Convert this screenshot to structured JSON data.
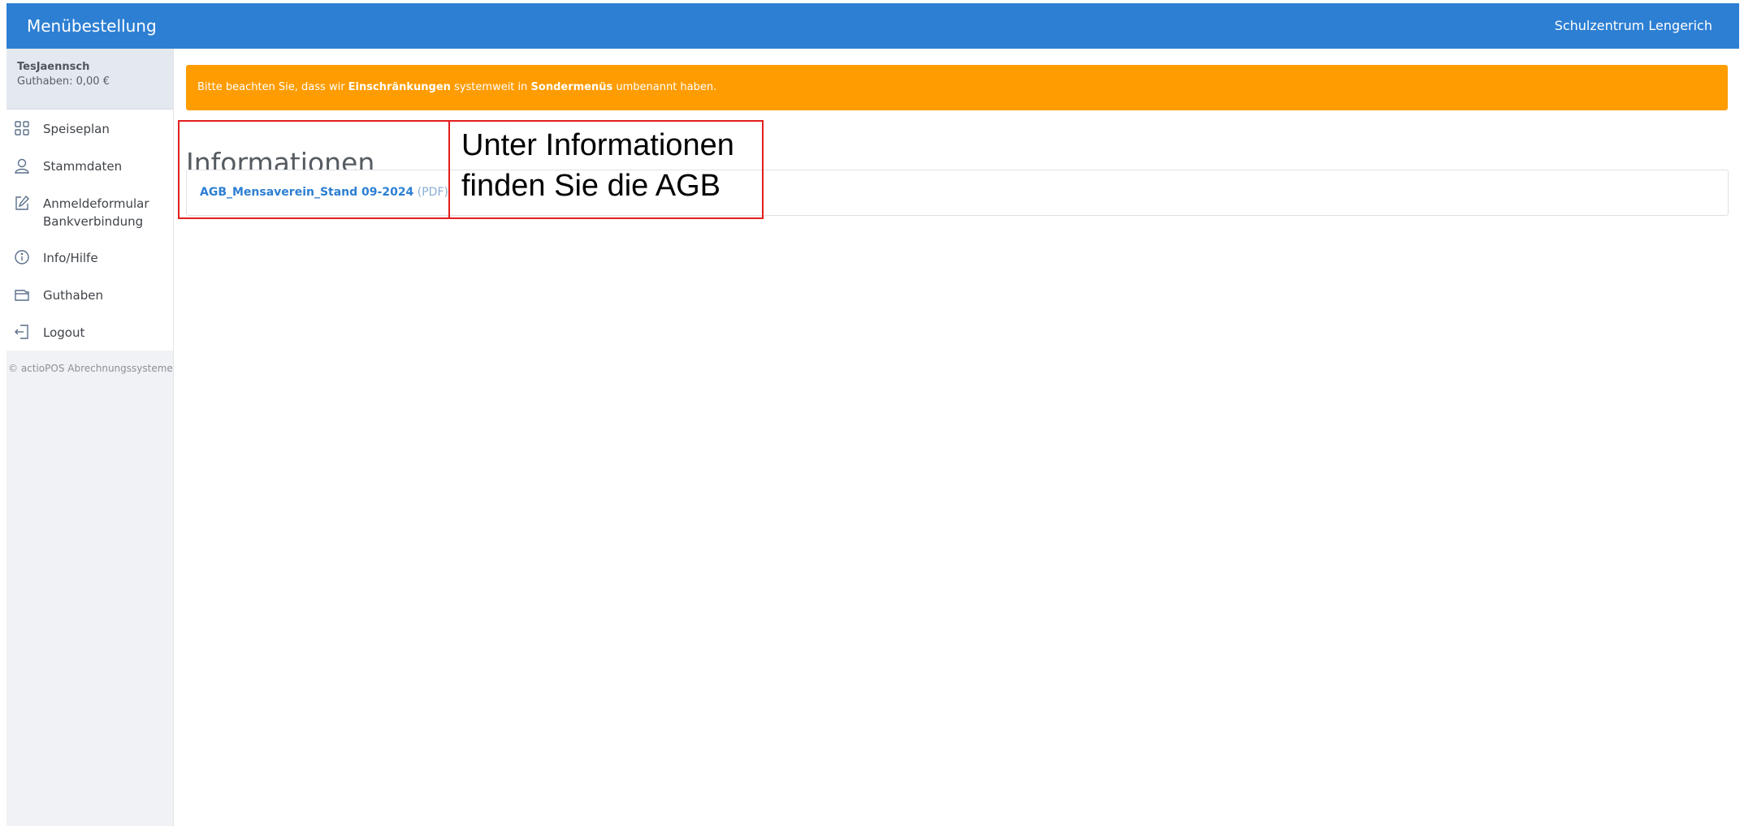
{
  "header": {
    "app_title": "Menübestellung",
    "school": "Schulzentrum Lengerich"
  },
  "sidebar": {
    "user": {
      "name": "TesJaennsch",
      "balance": "Guthaben: 0,00 €"
    },
    "items": [
      {
        "label": "Speiseplan",
        "icon": "grid-icon"
      },
      {
        "label": "Stammdaten",
        "icon": "user-icon"
      },
      {
        "label": "Anmeldeformular Bankverbindung",
        "icon": "edit-icon"
      },
      {
        "label": "Info/Hilfe",
        "icon": "info-icon"
      },
      {
        "label": "Guthaben",
        "icon": "wallet-icon"
      },
      {
        "label": "Logout",
        "icon": "logout-icon"
      }
    ],
    "footer": "© actioPOS Abrechnungssysteme"
  },
  "notice": {
    "part1": "Bitte beachten Sie, dass wir ",
    "bold1": "Einschränkungen",
    "part2": " systemweit in ",
    "bold2": "Sondermenüs",
    "part3": " umbenannt haben."
  },
  "main": {
    "title": "Informationen",
    "files": [
      {
        "name": "AGB_Mensaverein_Stand 09-2024",
        "type": "(PDF)"
      }
    ]
  },
  "annotation": {
    "line1": "Unter Informationen",
    "line2": "finden Sie die AGB",
    "color": "#e31e1e"
  },
  "colors": {
    "primary": "#2d7fd3",
    "notice": "#ff9c00"
  }
}
